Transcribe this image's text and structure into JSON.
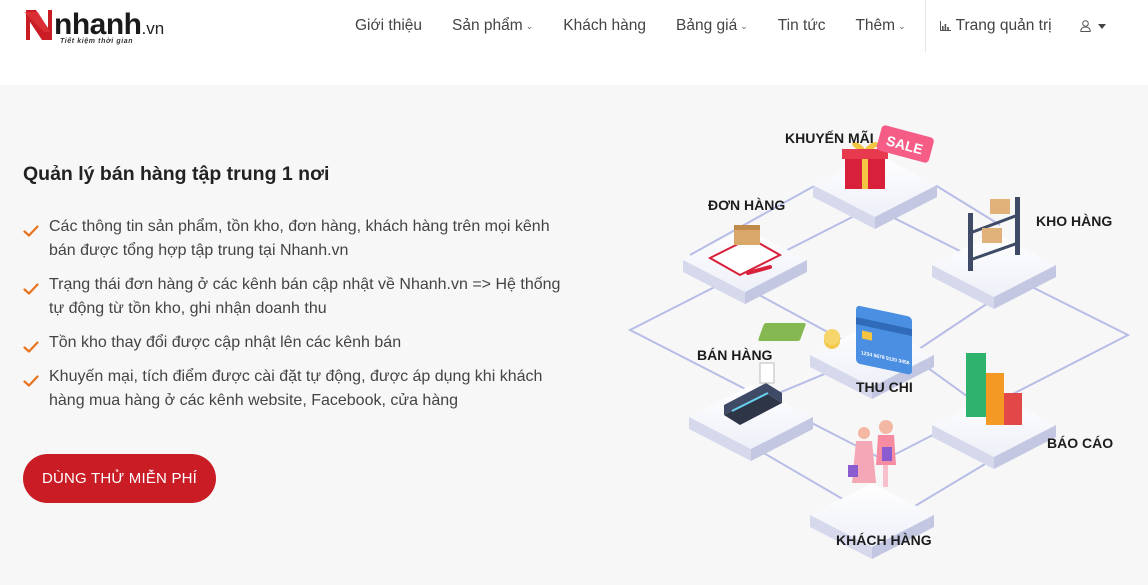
{
  "brand": {
    "wordmark": "nhanh",
    "domain": ".vn",
    "slogan": "Tiết kiệm thời gian",
    "accent": "#c91c25"
  },
  "nav": {
    "items": [
      {
        "label": "Giới thiệu",
        "dropdown": false
      },
      {
        "label": "Sản phẩm",
        "dropdown": true
      },
      {
        "label": "Khách hàng",
        "dropdown": false
      },
      {
        "label": "Bảng giá",
        "dropdown": true
      },
      {
        "label": "Tin tức",
        "dropdown": false
      },
      {
        "label": "Thêm",
        "dropdown": true
      }
    ],
    "chevron": "⌄",
    "admin_label": "Trang quản trị",
    "admin_icon": "bar-chart-icon",
    "user_icon": "user-icon"
  },
  "hero": {
    "title": "Quản lý bán hàng tập trung 1 nơi",
    "features": [
      "Các thông tin sản phẩm, tồn kho, đơn hàng, khách hàng trên mọi kênh bán được tổng hợp tập trung tại Nhanh.vn",
      "Trạng thái đơn hàng ở các kênh bán cập nhật về Nhanh.vn => Hệ thống tự động từ tồn kho, ghi nhận doanh thu",
      "Tồn kho thay đổi được cập nhật lên các kênh bán",
      "Khuyến mại, tích điểm được cài đặt tự động, được áp dụng khi khách hàng mua hàng ở các kênh website, Facebook, cửa hàng"
    ],
    "cta_label": "DÙNG THỬ MIỄN PHÍ",
    "check_color": "#e8731f"
  },
  "illustration": {
    "labels": {
      "khuyen_mai": "KHUYẾN MÃI",
      "don_hang": "ĐƠN HÀNG",
      "kho_hang": "KHO HÀNG",
      "ban_hang": "BÁN HÀNG",
      "thu_chi": "THU CHI",
      "bao_cao": "BÁO CÁO",
      "khach_hang": "KHÁCH HÀNG"
    },
    "sale_tag": "SALE",
    "card_number": "1234 5678 9120 3456"
  }
}
